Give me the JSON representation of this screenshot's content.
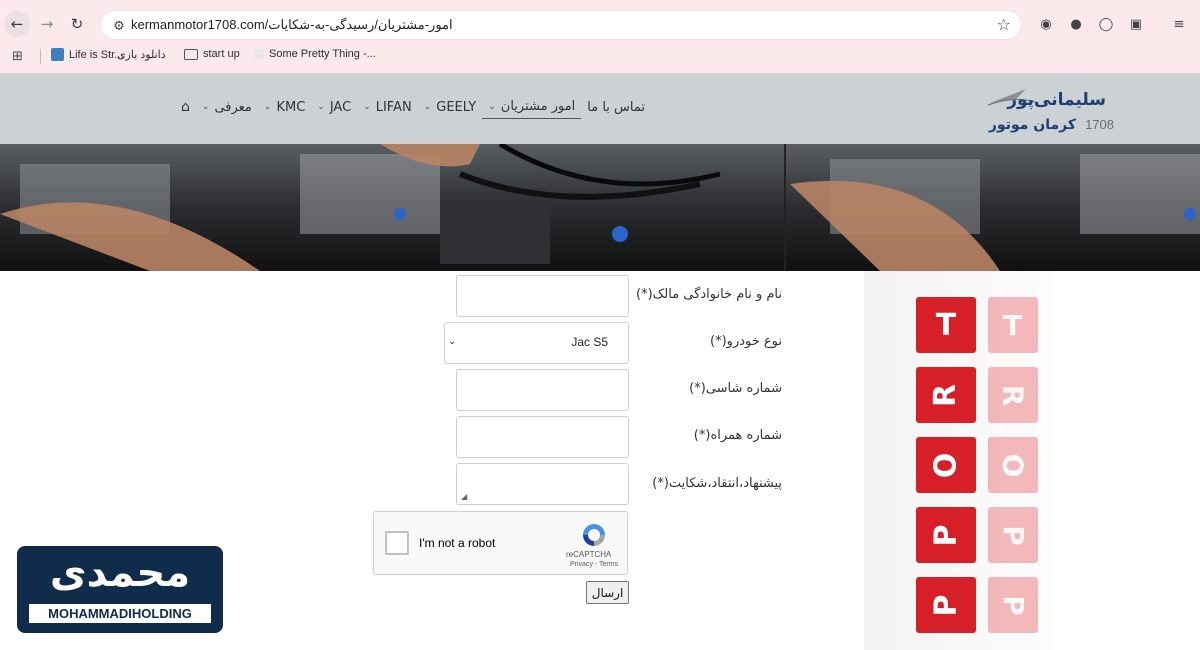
{
  "browser": {
    "url": "kermanmotor1708.com/امور-مشتریان/رسیدگی-به-شکایات",
    "bookmarks": [
      {
        "label": "Life is Str..."
      },
      {
        "label": "دانلود بازی"
      },
      {
        "label": "start up"
      },
      {
        "label": "Some Pretty Thing -..."
      }
    ]
  },
  "site": {
    "logo_name": "سلیمانی‌پور",
    "logo_sub": "کرمان موتور",
    "logo_num": "1708",
    "menu": [
      {
        "label": "معرفی",
        "dropdown": true
      },
      {
        "label": "KMC",
        "dropdown": true
      },
      {
        "label": "JAC",
        "dropdown": true
      },
      {
        "label": "LIFAN",
        "dropdown": true
      },
      {
        "label": "GEELY",
        "dropdown": true
      },
      {
        "label": "امور مشتریان",
        "dropdown": true
      },
      {
        "label": "تماس با ما",
        "dropdown": false
      }
    ]
  },
  "form": {
    "owner_name_label": "نام و نام خانوادگی مالک(*)",
    "car_type_label": "نوع خودرو(*)",
    "car_type_value": "Jac S5",
    "chassis_label": "شماره شاسی(*)",
    "mobile_label": "شماره همراه(*)",
    "feedback_label": "پیشنهاد،انتقاد،شکایت(*)",
    "recaptcha_text": "I'm not a robot",
    "recaptcha_brand": "reCAPTCHA",
    "recaptcha_terms": "Privacy - Terms",
    "submit_label": "ارسال"
  },
  "support_image": {
    "letters": [
      "T",
      "R",
      "O",
      "P",
      "P"
    ]
  },
  "watermark": {
    "persian": "محمدی",
    "english": "MOHAMMADIHOLDING"
  },
  "colors": {
    "chrome_bg": "#fbe9ec",
    "header_bg": "#ccd1d6",
    "cube_red": "#d61f26",
    "watermark_bg": "#0f2d4a"
  }
}
